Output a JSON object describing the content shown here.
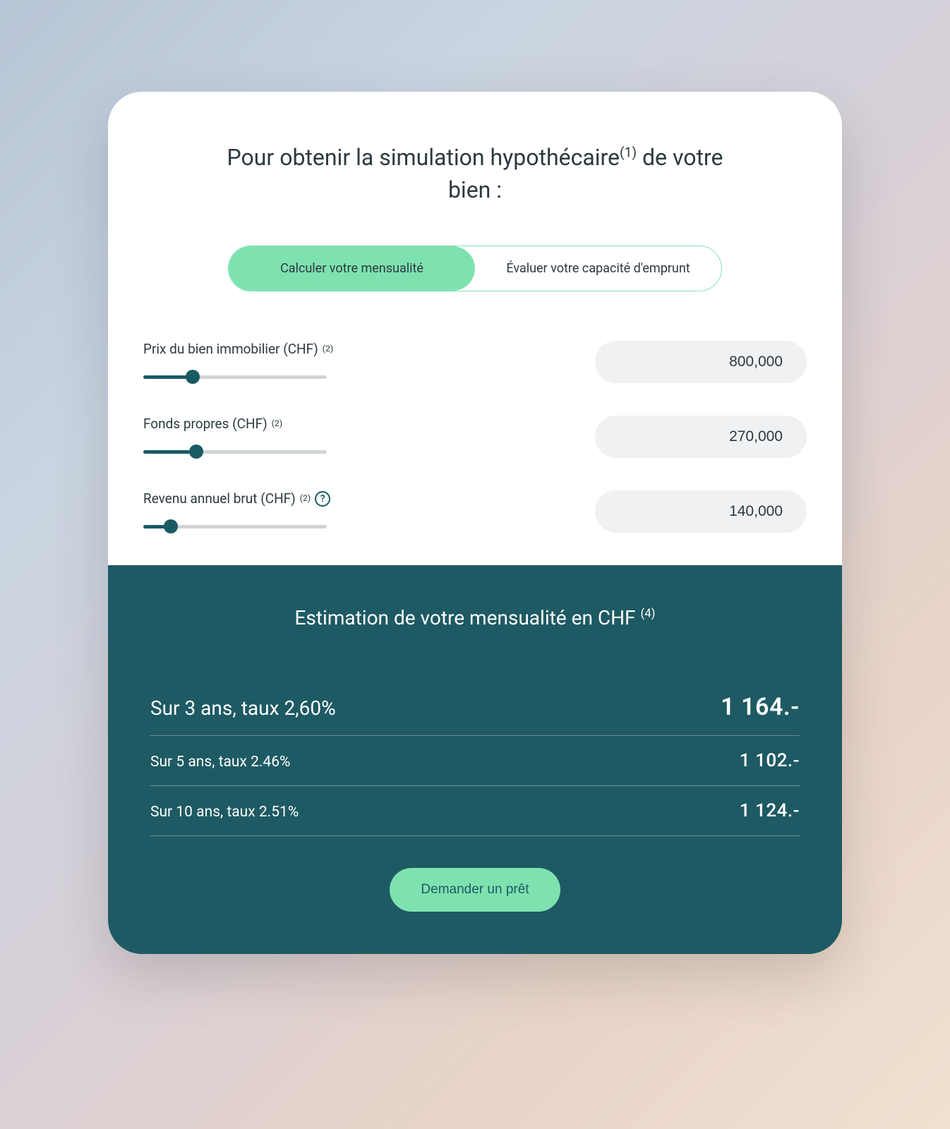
{
  "title": {
    "pre": "Pour obtenir la simulation hypothécaire",
    "sup": "(1)",
    "post": " de votre bien :"
  },
  "tabs": {
    "calc": "Calculer votre mensualité",
    "eval": "Évaluer votre capacité d'emprunt"
  },
  "fields": {
    "price": {
      "label": "Prix du bien immobilier (CHF)",
      "sup": "(2)",
      "value": "800,000",
      "slider_percent": 27
    },
    "equity": {
      "label": "Fonds propres (CHF)",
      "sup": "(2)",
      "value": "270,000",
      "slider_percent": 29
    },
    "income": {
      "label": "Revenu annuel brut (CHF)",
      "sup": "(2)",
      "value": "140,000",
      "slider_percent": 15,
      "has_help": true
    }
  },
  "results": {
    "title": "Estimation de votre mensualité en CHF",
    "sup": "(4)",
    "rows": [
      {
        "label": "Sur 3 ans, taux 2,60%",
        "value": "1 164.-",
        "primary": true
      },
      {
        "label": "Sur 5 ans, taux 2.46%",
        "value": "1 102.-",
        "primary": false
      },
      {
        "label": "Sur 10 ans, taux 2.51%",
        "value": "1 124.-",
        "primary": false
      }
    ]
  },
  "cta": "Demander un prêt"
}
